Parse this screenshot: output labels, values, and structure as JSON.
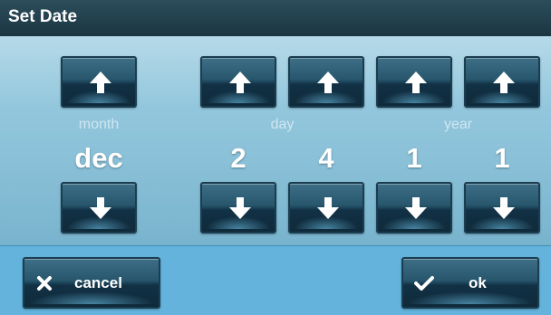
{
  "title": "Set Date",
  "labels": {
    "month": "month",
    "day": "day",
    "year": "year"
  },
  "values": {
    "month": "dec",
    "day_tens": "2",
    "day_ones": "4",
    "year_tens": "1",
    "year_ones": "1"
  },
  "buttons": {
    "cancel": "cancel",
    "ok": "ok"
  },
  "icons": {
    "increment": "arrow-up-icon",
    "decrement": "arrow-down-icon",
    "cancel": "x-icon",
    "ok": "checkmark-icon"
  },
  "colors": {
    "title_bar": "#1c3542",
    "picker_bg": "#8cc2d9",
    "footer_bg": "#63b3dc",
    "button": "#123145"
  }
}
